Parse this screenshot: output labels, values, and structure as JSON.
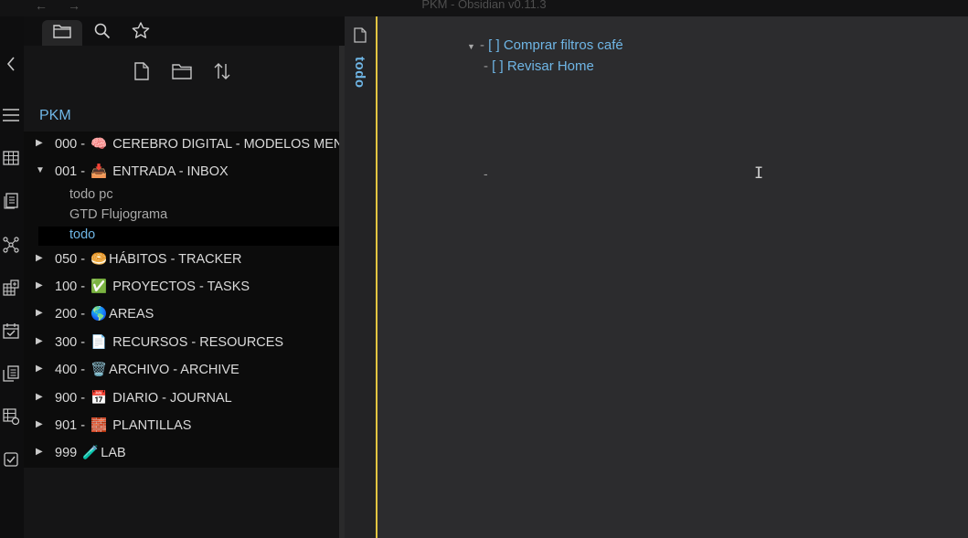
{
  "titlebar": {
    "title": "PKM - Obsidian v0.11.3",
    "back_icon": "←",
    "forward_icon": "→"
  },
  "ribbon": {
    "icons": [
      "chevron-left-icon",
      "menu-icon",
      "table-icon",
      "note-list-icon",
      "graph-icon",
      "calendar-grid-icon",
      "calendar-check-icon",
      "copy-icon",
      "table-settings-icon",
      "checkbox-icon"
    ]
  },
  "sidebar": {
    "tabs": [
      "folder-icon",
      "search-icon",
      "star-icon"
    ],
    "toolbar": [
      "new-note-icon",
      "new-folder-icon",
      "sort-icon"
    ],
    "vault_name": "PKM",
    "items": [
      {
        "type": "folder",
        "expanded": false,
        "prefix": "000 -",
        "emoji": "🧠",
        "name": "CEREBRO DIGITAL - MODELOS MENTALES"
      },
      {
        "type": "folder",
        "expanded": true,
        "prefix": "001 -",
        "emoji": "📥",
        "name": "ENTRADA - INBOX"
      },
      {
        "type": "file",
        "name": "todo pc",
        "active": false
      },
      {
        "type": "file",
        "name": "GTD Flujograma",
        "active": false
      },
      {
        "type": "file",
        "name": "todo",
        "active": true
      },
      {
        "type": "folder",
        "expanded": false,
        "prefix": "050 -",
        "emoji": "🥯",
        "name": "HÁBITOS - TRACKER"
      },
      {
        "type": "folder",
        "expanded": false,
        "prefix": "100 -",
        "emoji": "✅",
        "name": "PROYECTOS - TASKS"
      },
      {
        "type": "folder",
        "expanded": false,
        "prefix": "200 -",
        "emoji": "🌎",
        "name": "AREAS"
      },
      {
        "type": "folder",
        "expanded": false,
        "prefix": "300 -",
        "emoji": "📄",
        "name": "RECURSOS - RESOURCES"
      },
      {
        "type": "folder",
        "expanded": false,
        "prefix": "400 -",
        "emoji": "🗑️",
        "name": "ARCHIVO - ARCHIVE"
      },
      {
        "type": "folder",
        "expanded": false,
        "prefix": "900 -",
        "emoji": "📅",
        "name": "DIARIO - JOURNAL"
      },
      {
        "type": "folder",
        "expanded": false,
        "prefix": "901 -",
        "emoji": "🧱",
        "name": "PLANTILLAS"
      },
      {
        "type": "folder",
        "expanded": false,
        "prefix": "999",
        "emoji": "🧪",
        "name": "LAB"
      }
    ]
  },
  "editor": {
    "title": "todo",
    "lines": [
      {
        "prefix": "- ",
        "text": "[ ] Comprar filtros café"
      },
      {
        "prefix": "- ",
        "text": "[ ] Revisar Home"
      }
    ],
    "stray": "-"
  }
}
